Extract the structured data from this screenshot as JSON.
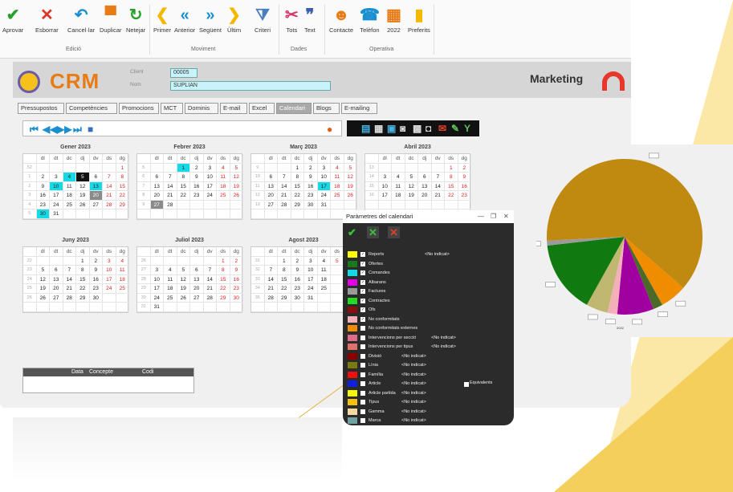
{
  "toolbar": {
    "buttons": [
      {
        "label": "Aprovar",
        "icon": "checkmark-icon",
        "color": "#2aa02a"
      },
      {
        "label": "Esborrar",
        "icon": "delete-x-icon",
        "color": "#e0312a"
      },
      {
        "label": "Cancel·lar",
        "icon": "undo-icon",
        "color": "#1a8fd0"
      },
      {
        "label": "Duplicar",
        "icon": "duplicate-icon",
        "color": "#e87b14"
      },
      {
        "label": "Netejar",
        "icon": "refresh-icon",
        "color": "#2aa02a"
      },
      {
        "label": "Primer",
        "icon": "first-icon",
        "color": "#f5b800"
      },
      {
        "label": "Anterior",
        "icon": "previous-icon",
        "color": "#1a8fd0"
      },
      {
        "label": "Següent",
        "icon": "next-icon",
        "color": "#1a8fd0"
      },
      {
        "label": "Últim",
        "icon": "last-icon",
        "color": "#f5b800"
      },
      {
        "label": "Criteri",
        "icon": "filter-icon",
        "color": "#4a7fbf"
      },
      {
        "label": "Tots",
        "icon": "scissors-icon",
        "color": "#d8326a"
      },
      {
        "label": "Text",
        "icon": "quote-icon",
        "color": "#3a5fb0"
      },
      {
        "label": "Contacte",
        "icon": "contact-icon",
        "color": "#e87b14"
      },
      {
        "label": "Telèfon",
        "icon": "phone-icon",
        "color": "#1a8fd0"
      },
      {
        "label": "2022",
        "icon": "calendar-icon",
        "color": "#e87b14"
      },
      {
        "label": "Preferits",
        "icon": "bar-chart-icon",
        "color": "#f5b800"
      }
    ],
    "groups": [
      "Edició",
      "Moviment",
      "Dades",
      "Operativa"
    ]
  },
  "header": {
    "logo": "CRM",
    "client_label": "Client",
    "client_value": "00005",
    "name_label": "Nom",
    "name_value": "SUPLIAN",
    "module": "Marketing"
  },
  "tabs": [
    "Pressupostos",
    "Competències",
    "Promocions",
    "MCT",
    "Dominis",
    "E-mail",
    "Excel",
    "Calendari",
    "Blogs",
    "E-mailing"
  ],
  "active_tab": "Calendari",
  "calendar": {
    "weekday_headers": [
      "dl",
      "dt",
      "dc",
      "dj",
      "dv",
      "ds",
      "dg"
    ],
    "months": [
      {
        "title": "Gener 2023",
        "rows": [
          {
            "wk": "52",
            "days": [
              "",
              "",
              "",
              "",
              "",
              "",
              "1"
            ]
          },
          {
            "wk": "1",
            "days": [
              "2",
              "3",
              "4",
              "5",
              "6",
              "7",
              "8"
            ]
          },
          {
            "wk": "2",
            "days": [
              "9",
              "10",
              "11",
              "12",
              "13",
              "14",
              "15"
            ]
          },
          {
            "wk": "3",
            "days": [
              "16",
              "17",
              "18",
              "19",
              "20",
              "21",
              "22"
            ]
          },
          {
            "wk": "4",
            "days": [
              "23",
              "24",
              "25",
              "26",
              "27",
              "28",
              "29"
            ]
          },
          {
            "wk": "5",
            "days": [
              "30",
              "31",
              "",
              "",
              "",
              "",
              ""
            ]
          }
        ]
      },
      {
        "title": "Febrer 2023",
        "rows": [
          {
            "wk": "5",
            "days": [
              "",
              "",
              "1",
              "2",
              "3",
              "4",
              "5"
            ]
          },
          {
            "wk": "6",
            "days": [
              "6",
              "7",
              "8",
              "9",
              "10",
              "11",
              "12"
            ]
          },
          {
            "wk": "7",
            "days": [
              "13",
              "14",
              "15",
              "16",
              "17",
              "18",
              "19"
            ]
          },
          {
            "wk": "8",
            "days": [
              "20",
              "21",
              "22",
              "23",
              "24",
              "25",
              "26"
            ]
          },
          {
            "wk": "9",
            "days": [
              "27",
              "28",
              "",
              "",
              "",
              "",
              ""
            ]
          },
          {
            "wk": "",
            "days": [
              "",
              "",
              "",
              "",
              "",
              "",
              ""
            ]
          }
        ]
      },
      {
        "title": "Març 2023",
        "rows": [
          {
            "wk": "9",
            "days": [
              "",
              "",
              "1",
              "2",
              "3",
              "4",
              "5"
            ]
          },
          {
            "wk": "10",
            "days": [
              "6",
              "7",
              "8",
              "9",
              "10",
              "11",
              "12"
            ]
          },
          {
            "wk": "11",
            "days": [
              "13",
              "14",
              "15",
              "16",
              "17",
              "18",
              "19"
            ]
          },
          {
            "wk": "12",
            "days": [
              "20",
              "21",
              "22",
              "23",
              "24",
              "25",
              "26"
            ]
          },
          {
            "wk": "13",
            "days": [
              "27",
              "28",
              "29",
              "30",
              "31",
              "",
              ""
            ]
          },
          {
            "wk": "",
            "days": [
              "",
              "",
              "",
              "",
              "",
              "",
              ""
            ]
          }
        ]
      },
      {
        "title": "Abril 2023",
        "rows": [
          {
            "wk": "13",
            "days": [
              "",
              "",
              "",
              "",
              "",
              "1",
              "2"
            ]
          },
          {
            "wk": "14",
            "days": [
              "3",
              "4",
              "5",
              "6",
              "7",
              "8",
              "9"
            ]
          },
          {
            "wk": "15",
            "days": [
              "10",
              "11",
              "12",
              "13",
              "14",
              "15",
              "16"
            ]
          },
          {
            "wk": "16",
            "days": [
              "17",
              "18",
              "19",
              "20",
              "21",
              "22",
              "23"
            ]
          },
          {
            "wk": "",
            "days": [
              "",
              "",
              "",
              "",
              "",
              "",
              ""
            ]
          },
          {
            "wk": "",
            "days": [
              "",
              "",
              "",
              "",
              "",
              "",
              ""
            ]
          }
        ]
      },
      {
        "title": "Juny 2023",
        "rows": [
          {
            "wk": "22",
            "days": [
              "",
              "",
              "",
              "1",
              "2",
              "3",
              "4"
            ]
          },
          {
            "wk": "23",
            "days": [
              "5",
              "6",
              "7",
              "8",
              "9",
              "10",
              "11"
            ]
          },
          {
            "wk": "24",
            "days": [
              "12",
              "13",
              "14",
              "15",
              "16",
              "17",
              "18"
            ]
          },
          {
            "wk": "25",
            "days": [
              "19",
              "20",
              "21",
              "22",
              "23",
              "24",
              "25"
            ]
          },
          {
            "wk": "26",
            "days": [
              "26",
              "27",
              "28",
              "29",
              "30",
              "",
              ""
            ]
          },
          {
            "wk": "",
            "days": [
              "",
              "",
              "",
              "",
              "",
              "",
              ""
            ]
          }
        ]
      },
      {
        "title": "Juliol 2023",
        "rows": [
          {
            "wk": "26",
            "days": [
              "",
              "",
              "",
              "",
              "",
              "1",
              "2"
            ]
          },
          {
            "wk": "27",
            "days": [
              "3",
              "4",
              "5",
              "6",
              "7",
              "8",
              "9"
            ]
          },
          {
            "wk": "28",
            "days": [
              "10",
              "11",
              "12",
              "13",
              "14",
              "15",
              "16"
            ]
          },
          {
            "wk": "29",
            "days": [
              "17",
              "18",
              "19",
              "20",
              "21",
              "22",
              "23"
            ]
          },
          {
            "wk": "30",
            "days": [
              "24",
              "25",
              "26",
              "27",
              "28",
              "29",
              "30"
            ]
          },
          {
            "wk": "31",
            "days": [
              "31",
              "",
              "",
              "",
              "",
              "",
              ""
            ]
          }
        ]
      },
      {
        "title": "Agost 2023",
        "rows": [
          {
            "wk": "31",
            "days": [
              "",
              "1",
              "2",
              "3",
              "4",
              "5",
              ""
            ]
          },
          {
            "wk": "32",
            "days": [
              "7",
              "8",
              "9",
              "10",
              "11",
              "",
              ""
            ]
          },
          {
            "wk": "33",
            "days": [
              "14",
              "15",
              "16",
              "17",
              "18",
              "",
              ""
            ]
          },
          {
            "wk": "34",
            "days": [
              "21",
              "22",
              "23",
              "24",
              "25",
              "",
              ""
            ]
          },
          {
            "wk": "35",
            "days": [
              "28",
              "29",
              "30",
              "31",
              "",
              "",
              ""
            ]
          },
          {
            "wk": "",
            "days": [
              "",
              "",
              "",
              "",
              "",
              "",
              ""
            ]
          }
        ]
      }
    ],
    "highlight_colors": {
      "cyan": "#16d9e6",
      "black": "#111111",
      "gray": "#8a8a8a"
    }
  },
  "bottom_table": {
    "columns": [
      "Data",
      "Concepte",
      "Codi"
    ]
  },
  "dialog": {
    "title": "Paràmetres del calendari",
    "window_controls": [
      "—",
      "❐",
      "✕"
    ],
    "no_indicat": "<No indicat>",
    "equivalents": "Equivalents",
    "rows": [
      {
        "name": "Reports",
        "color": "#ffff00",
        "checked": true,
        "value": "<No indicat>"
      },
      {
        "name": "Ofertes",
        "color": "#1a7a1a",
        "checked": true,
        "value": ""
      },
      {
        "name": "Comandes",
        "color": "#16d9e6",
        "checked": true,
        "value": ""
      },
      {
        "name": "Albarans",
        "color": "#e000e0",
        "checked": true,
        "value": ""
      },
      {
        "name": "Factures",
        "color": "#9a9a9a",
        "checked": true,
        "value": ""
      },
      {
        "name": "Contractes",
        "color": "#22dd22",
        "checked": true,
        "value": ""
      },
      {
        "name": "Ofs",
        "color": "#8a1010",
        "checked": true,
        "value": ""
      },
      {
        "name": "No conformitats",
        "color": "#f4b0b8",
        "checked": true,
        "value": ""
      },
      {
        "name": "No conformitats externes",
        "color": "#f08c00",
        "checked": false,
        "value": ""
      },
      {
        "name": "Intervencions per secció",
        "color": "#e06a8a",
        "checked": false,
        "value": "<No indicat>"
      },
      {
        "name": "Intervencions per tipus",
        "color": "#e0706a",
        "checked": false,
        "value": "<No indicat>"
      },
      {
        "name": "Divisió",
        "color": "#8a0000",
        "checked": false,
        "value": "<No indicat>"
      },
      {
        "name": "Línia",
        "color": "#7a7a10",
        "checked": false,
        "value": "<No indicat>"
      },
      {
        "name": "Família",
        "color": "#ee1010",
        "checked": false,
        "value": "<No indicat>"
      },
      {
        "name": "Article",
        "color": "#1020dd",
        "checked": false,
        "value": "<No indicat>"
      },
      {
        "name": "Article partida",
        "color": "#f5f510",
        "checked": false,
        "value": "<No indicat>"
      },
      {
        "name": "Tipus",
        "color": "#f5c010",
        "checked": false,
        "value": "<No indicat>"
      },
      {
        "name": "Gamma",
        "color": "#f5d9a0",
        "checked": false,
        "value": "<No indicat>"
      },
      {
        "name": "Marca",
        "color": "#70a0a0",
        "checked": false,
        "value": "<No indicat>"
      }
    ]
  },
  "chart_data": {
    "type": "pie",
    "values": [
      61.7,
      5.5,
      2.0,
      7.5,
      2.0,
      4.5,
      15.0,
      1.0
    ],
    "colors": [
      "#c08a10",
      "#f08c00",
      "#4a6a2a",
      "#a000a0",
      "#f4b0b8",
      "#c0b870",
      "#107a10",
      "#9a9a9a"
    ],
    "label_text": "2022"
  }
}
